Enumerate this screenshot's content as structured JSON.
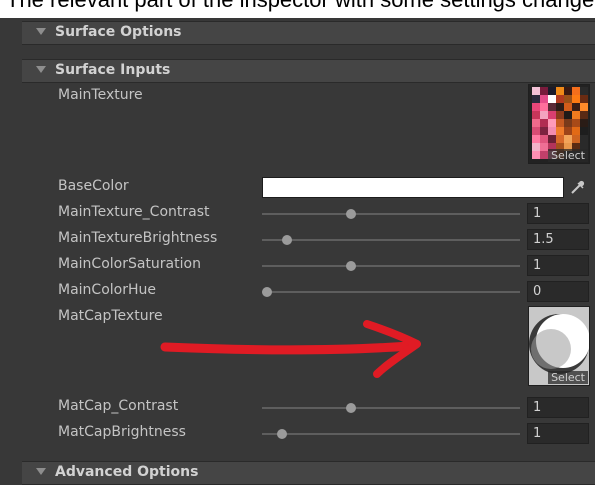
{
  "colors": {
    "panel_bg": "#383838",
    "header_bg": "#454545",
    "field_bg": "#2a2a2a",
    "color_swatch": "#ffffff",
    "annotation_arrow": "#e01b24"
  },
  "sections": {
    "surface_options": {
      "label": "Surface Options",
      "icon": "foldout-triangle-icon"
    },
    "surface_inputs": {
      "label": "Surface Inputs",
      "icon": "foldout-triangle-icon"
    },
    "advanced_options": {
      "label": "Advanced Options",
      "icon": "foldout-triangle-icon"
    }
  },
  "properties": {
    "main_texture": {
      "label": "MainTexture",
      "select_label": "Select"
    },
    "base_color": {
      "label": "BaseColor",
      "value": "#ffffff",
      "picker_icon": "eyedropper-icon"
    },
    "main_texture_contrast": {
      "label": "MainTexture_Contrast",
      "value": "1",
      "slider_fraction": 0.34
    },
    "main_texture_brightness": {
      "label": "MainTextureBrightness",
      "value": "1.5",
      "slider_fraction": 0.08
    },
    "main_color_saturation": {
      "label": "MainColorSaturation",
      "value": "1",
      "slider_fraction": 0.34
    },
    "main_color_hue": {
      "label": "MainColorHue",
      "value": "0",
      "slider_fraction": 0.0
    },
    "matcap_texture": {
      "label": "MatCapTexture",
      "select_label": "Select"
    },
    "matcap_contrast": {
      "label": "MatCap_Contrast",
      "value": "1",
      "slider_fraction": 0.34
    },
    "matcap_brightness": {
      "label": "MatCapBrightness",
      "value": "1",
      "slider_fraction": 0.06
    }
  },
  "annotation": {
    "shape": "red-hand-drawn-arrow",
    "direction": "right"
  }
}
